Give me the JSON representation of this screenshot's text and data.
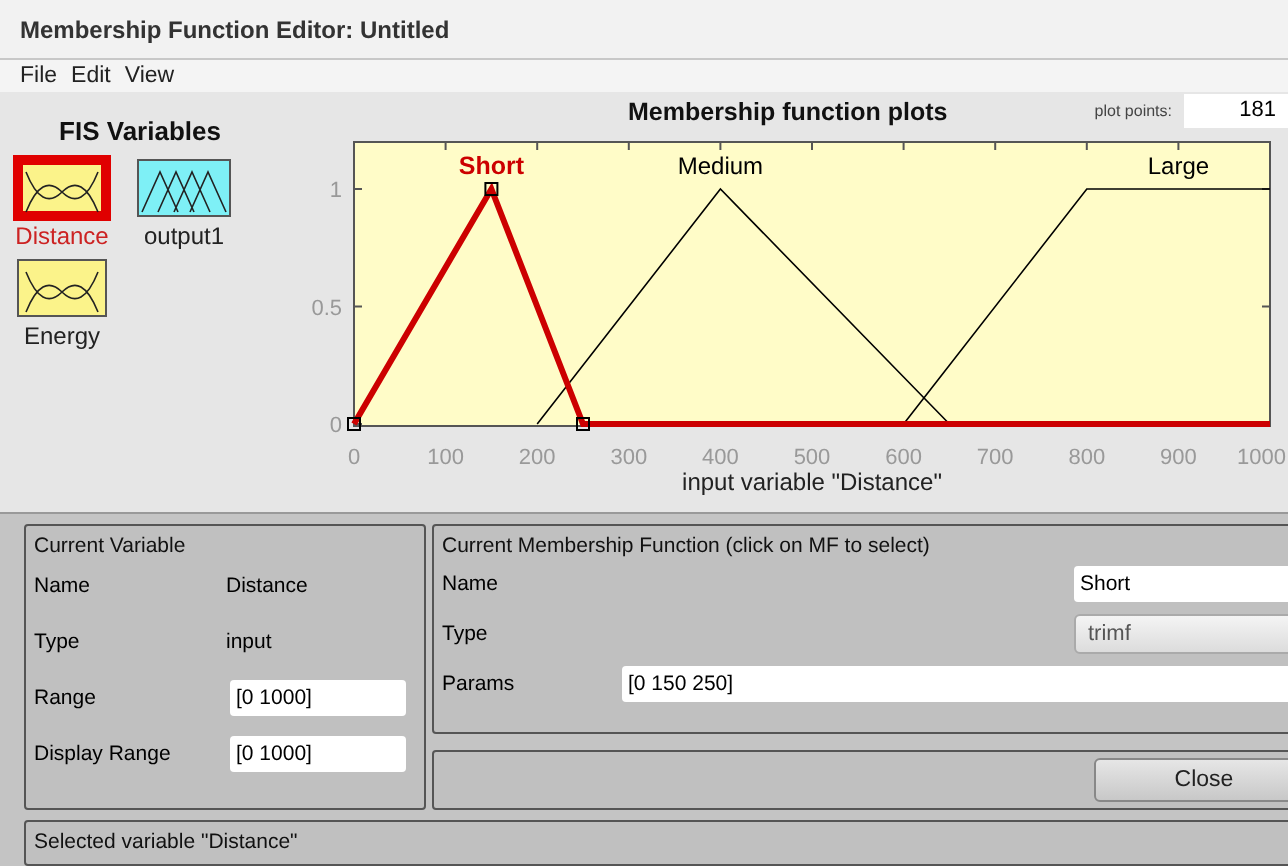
{
  "window": {
    "title": "Membership Function Editor: Untitled"
  },
  "menu": [
    "File",
    "Edit",
    "View"
  ],
  "fis_variables": {
    "title": "FIS Variables",
    "items": [
      {
        "name": "Distance",
        "kind": "input",
        "selected": true
      },
      {
        "name": "output1",
        "kind": "output",
        "selected": false
      },
      {
        "name": "Energy",
        "kind": "input",
        "selected": false
      }
    ]
  },
  "plot": {
    "title": "Membership function plots",
    "plot_points_label": "plot points:",
    "plot_points": "181",
    "chart_data": {
      "type": "line",
      "xlabel": "input variable \"Distance\"",
      "x": [
        0,
        150,
        200,
        250,
        400,
        600,
        650,
        800,
        1000
      ],
      "series": [
        {
          "name": "Short",
          "color": "#cc0000",
          "values": [
            0,
            1,
            0.5,
            0,
            0,
            0,
            0,
            0,
            0
          ]
        },
        {
          "name": "Medium",
          "color": "#000000",
          "values": [
            null,
            null,
            0,
            0.25,
            1,
            0.2,
            0,
            null,
            null
          ]
        },
        {
          "name": "Large",
          "color": "#000000",
          "values": [
            null,
            null,
            null,
            null,
            null,
            0,
            0.25,
            1,
            1
          ]
        }
      ],
      "xlim": [
        0,
        1000
      ],
      "ylim": [
        0,
        1.2
      ],
      "xticks": [
        0,
        100,
        200,
        300,
        400,
        500,
        600,
        700,
        800,
        900,
        1000
      ],
      "yticks": [
        0,
        0.5,
        1
      ]
    },
    "mf_selection": [
      {
        "selected": true
      },
      {
        "selected": false
      },
      {
        "selected": false
      }
    ]
  },
  "current_variable": {
    "title": "Current Variable",
    "fields": [
      {
        "label": "Name",
        "value": "Distance",
        "kind": "text"
      },
      {
        "label": "Type",
        "value": "input",
        "kind": "text"
      },
      {
        "label": "Range",
        "value": "[0 1000]",
        "kind": "input"
      },
      {
        "label": "Display Range",
        "value": "[0 1000]",
        "kind": "input"
      }
    ]
  },
  "current_mf": {
    "title": "Current Membership Function (click on MF to select)",
    "name_label": "Name",
    "name": "Short",
    "type_label": "Type",
    "type": "trimf",
    "params_label": "Params",
    "params": "[0 150 250]"
  },
  "buttons": [
    {
      "label": "Close"
    }
  ],
  "status": "Selected variable \"Distance\""
}
